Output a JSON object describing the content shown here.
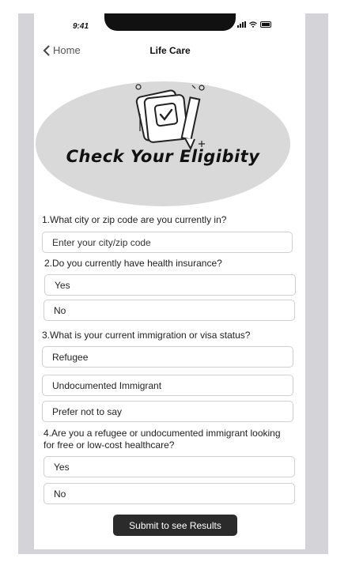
{
  "status_bar": {
    "time": "9:41"
  },
  "nav": {
    "back_label": "Home",
    "title": "Life Care"
  },
  "hero": {
    "title": "Check Your Eligibity",
    "icon": "document-checkmark-pencil-icon"
  },
  "form": {
    "q1": {
      "text": "1.What city or zip code are you currently in?",
      "placeholder": "Enter your city/zip code",
      "value": ""
    },
    "q2": {
      "text": "2.Do you currently have health insurance?",
      "options": [
        "Yes",
        "No"
      ]
    },
    "q3": {
      "text": "3.What is your current immigration or visa status?",
      "options": [
        "Refugee",
        "Undocumented Immigrant",
        "Prefer not to say"
      ]
    },
    "q4": {
      "text": "4.Are you a refugee or undocumented immigrant looking for free or low-cost healthcare?",
      "options": [
        "Yes",
        "No"
      ]
    }
  },
  "submit_label": "Submit to see Results",
  "colors": {
    "hero_bg": "#d9d9d9",
    "button_bg": "#2b2b2b",
    "frame_bg": "#d4d4d8"
  }
}
